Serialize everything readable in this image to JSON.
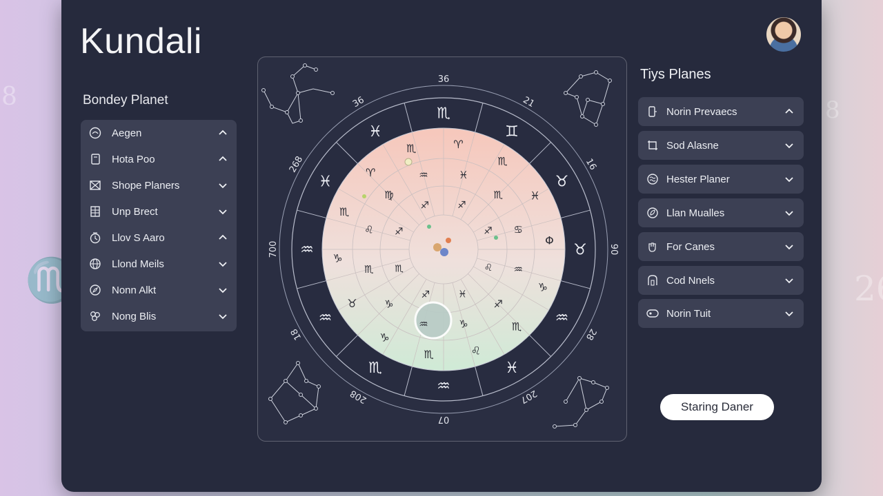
{
  "app": {
    "title": "Kundali"
  },
  "left_panel": {
    "heading": "Bondey Planet",
    "items": [
      {
        "label": "Aegen",
        "icon": "circle-icon",
        "expanded": true
      },
      {
        "label": "Hota Poo",
        "icon": "tablet-icon",
        "expanded": true
      },
      {
        "label": "Shope Planers",
        "icon": "envelope-icon",
        "expanded": false
      },
      {
        "label": "Unp Brect",
        "icon": "grid-icon",
        "expanded": false
      },
      {
        "label": "Llov S Aaro",
        "icon": "clock-icon",
        "expanded": true
      },
      {
        "label": "Llond Meils",
        "icon": "globe-icon",
        "expanded": false
      },
      {
        "label": "Nonn Alkt",
        "icon": "compass-icon",
        "expanded": false
      },
      {
        "label": "Nong Blis",
        "icon": "flower-icon",
        "expanded": false
      }
    ]
  },
  "right_panel": {
    "heading": "Tiys Planes",
    "items": [
      {
        "label": "Norin Prevaecs",
        "icon": "phone-icon",
        "expanded": true
      },
      {
        "label": "Sod Alasne",
        "icon": "crop-icon",
        "expanded": false
      },
      {
        "label": "Hester Planer",
        "icon": "pattern-icon",
        "expanded": false
      },
      {
        "label": "Llan Mualles",
        "icon": "leaf-icon",
        "expanded": false
      },
      {
        "label": "For Canes",
        "icon": "hand-icon",
        "expanded": false
      },
      {
        "label": "Cod Nnels",
        "icon": "door-icon",
        "expanded": false
      },
      {
        "label": "Norin Tuit",
        "icon": "pill-icon",
        "expanded": false
      }
    ]
  },
  "chart": {
    "degree_labels": [
      "36",
      "21",
      "16",
      "90",
      "28",
      "207",
      "07",
      "208",
      "18",
      "700",
      "268",
      "36"
    ],
    "outer_signs": [
      "♏",
      "♊",
      "♉",
      "♉",
      "♒",
      "♓",
      "♒",
      "♏",
      "♒",
      "♒",
      "♓",
      "♓"
    ],
    "mid_signs": [
      "♈",
      "♏",
      "♓",
      "Φ",
      "♑",
      "♏",
      "♌",
      "♏",
      "♑",
      "♉",
      "♑",
      "♏",
      "♈",
      "♏"
    ],
    "inner_signs": [
      "♓",
      "♏",
      "♋",
      "♒",
      "♐",
      "♑",
      "♒",
      "♑",
      "♏",
      "♌",
      "♍",
      "♒"
    ],
    "core_signs": [
      "♐",
      "♐",
      "♌",
      "♓",
      "♐",
      "♏",
      "♐",
      "♐"
    ]
  },
  "cta": {
    "label": "Staring Daner"
  },
  "colors": {
    "panel": "#262a3d",
    "card": "#3c4054",
    "accent": "#ffffff"
  }
}
